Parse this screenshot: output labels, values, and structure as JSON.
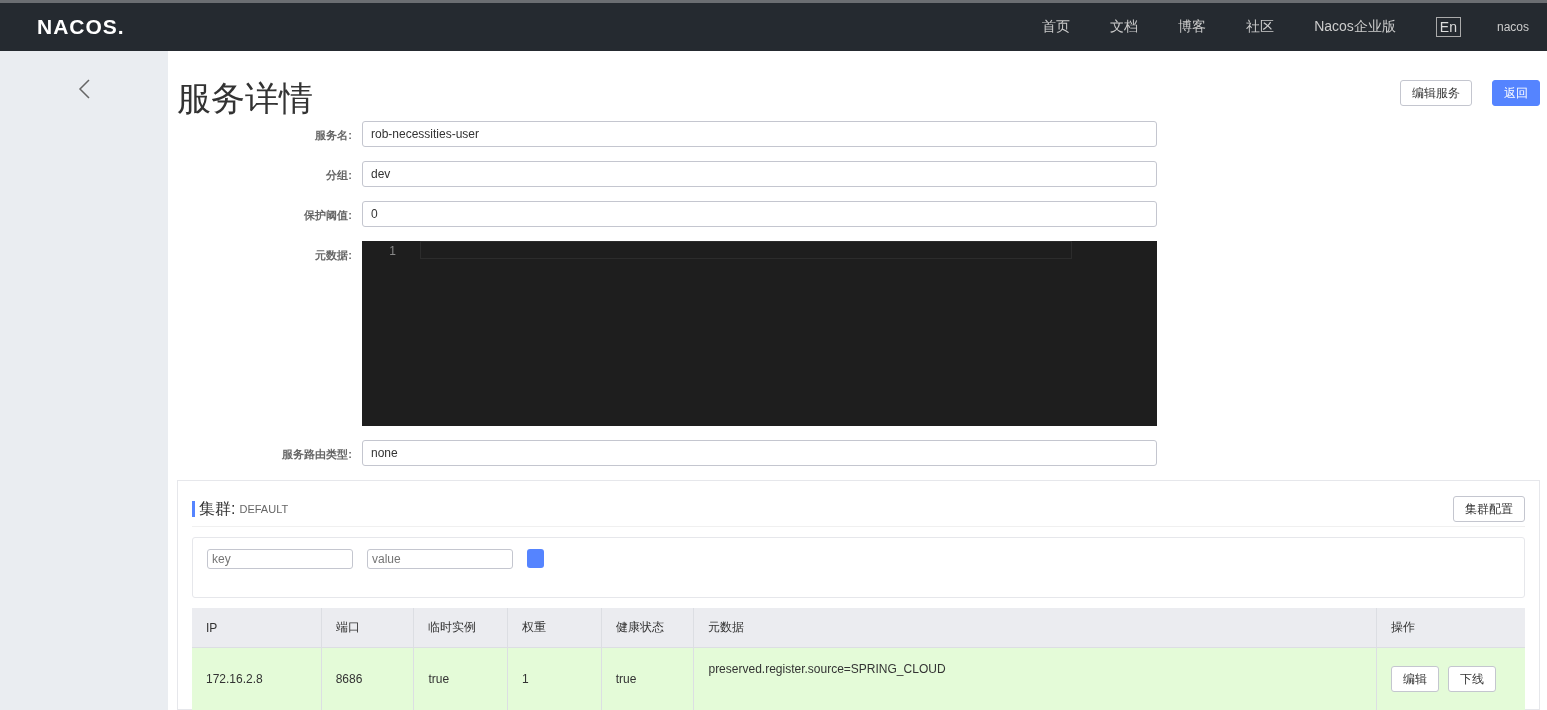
{
  "header": {
    "logo": "NACOS.",
    "nav": [
      "首页",
      "文档",
      "博客",
      "社区",
      "Nacos企业版"
    ],
    "language": "En",
    "user": "nacos"
  },
  "page": {
    "title": "服务详情",
    "buttons": [
      {
        "label": "编辑服务",
        "kind": "default"
      },
      {
        "label": "返回",
        "kind": "primary"
      }
    ]
  },
  "form": [
    {
      "label": "服务名:",
      "kind": "input",
      "value": "rob-necessities-user"
    },
    {
      "label": "分组:",
      "kind": "input",
      "value": "dev"
    },
    {
      "label": "保护阈值:",
      "kind": "input",
      "value": "0"
    },
    {
      "label": "元数据:",
      "kind": "editor",
      "line_number": "1"
    },
    {
      "label": "服务路由类型:",
      "kind": "input",
      "value": "none"
    }
  ],
  "cluster": {
    "label": "集群:",
    "name": "DEFAULT",
    "button": "集群配置",
    "filter": {
      "key_placeholder": "key",
      "value_placeholder": "value"
    },
    "table": {
      "columns": [
        "IP",
        "端口",
        "临时实例",
        "权重",
        "健康状态",
        "元数据",
        "操作"
      ],
      "rows": [
        {
          "cells": [
            "172.16.2.8",
            "8686",
            "true",
            "1",
            "true",
            "preserved.register.source=SPRING_CLOUD"
          ],
          "actions": [
            "编辑",
            "下线"
          ]
        }
      ]
    }
  }
}
